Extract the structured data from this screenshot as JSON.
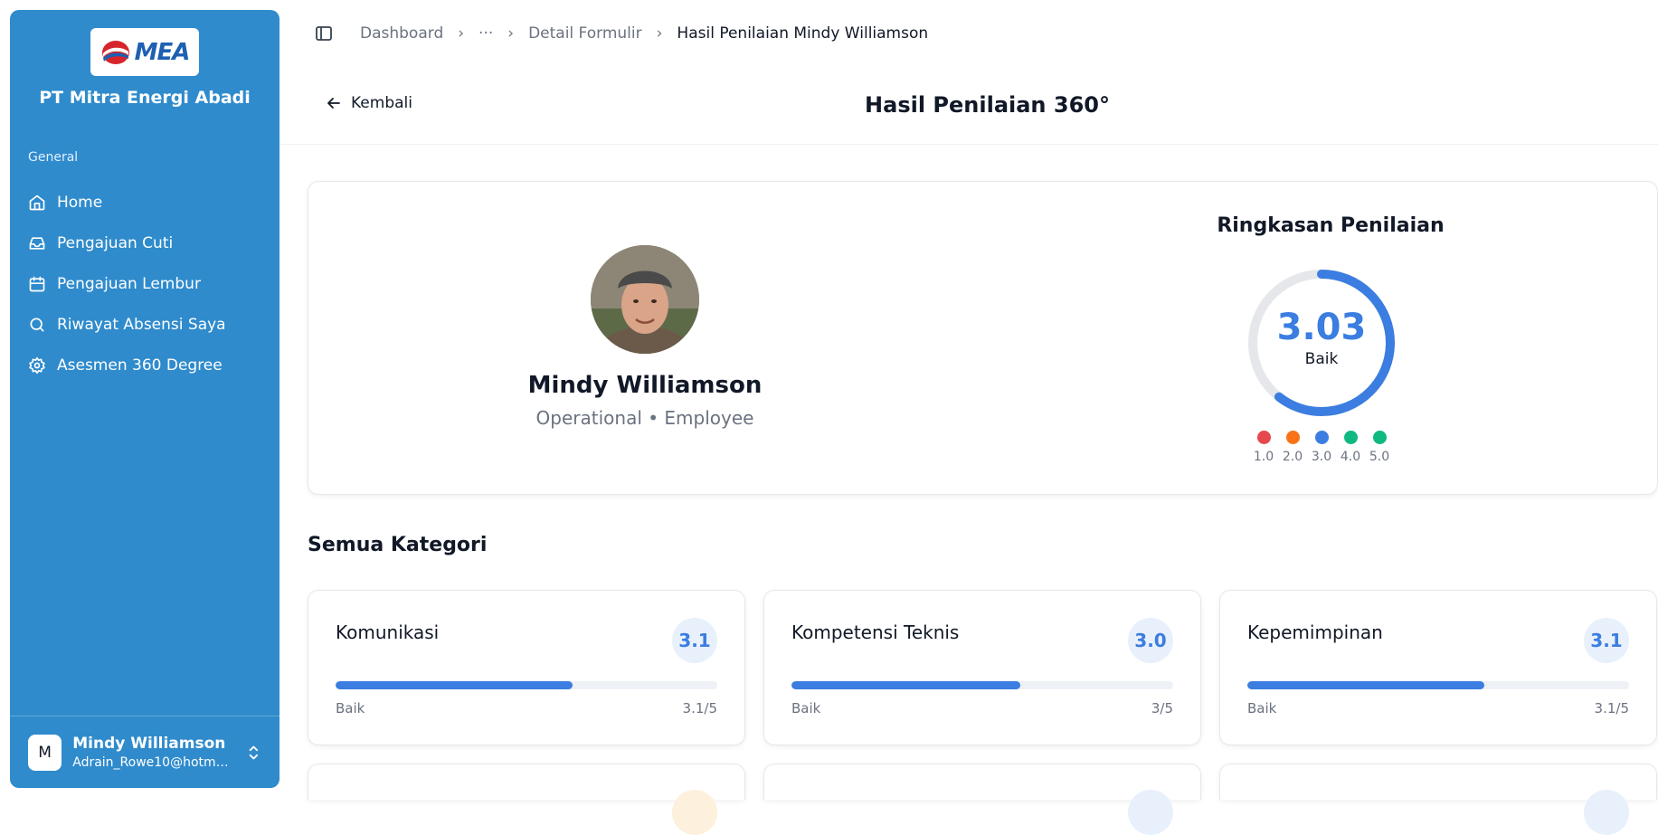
{
  "sidebar": {
    "logo_text": "MEA",
    "company": "PT Mitra Energi Abadi",
    "group_label": "General",
    "items": [
      {
        "label": "Home",
        "icon": "home-icon"
      },
      {
        "label": "Pengajuan Cuti",
        "icon": "inbox-icon"
      },
      {
        "label": "Pengajuan Lembur",
        "icon": "calendar-icon"
      },
      {
        "label": "Riwayat Absensi Saya",
        "icon": "search-icon"
      },
      {
        "label": "Asesmen 360 Degree",
        "icon": "gear-icon"
      }
    ],
    "user": {
      "initial": "M",
      "name": "Mindy Williamson",
      "email": "Adrain_Rowe10@hotmail.com"
    }
  },
  "breadcrumb": {
    "items": [
      "Dashboard",
      "···",
      "Detail Formulir"
    ],
    "current": "Hasil Penilaian Mindy Williamson"
  },
  "header": {
    "back_label": "Kembali",
    "title": "Hasil Penilaian 360°"
  },
  "profile": {
    "name": "Mindy Williamson",
    "role": "Operational • Employee"
  },
  "summary": {
    "title": "Ringkasan Penilaian",
    "score": "3.03",
    "score_value": 3.03,
    "score_max": 5,
    "label": "Baik",
    "scale": [
      {
        "value": "1.0",
        "color": "#e5484d"
      },
      {
        "value": "2.0",
        "color": "#f97316"
      },
      {
        "value": "3.0",
        "color": "#3b7de0"
      },
      {
        "value": "4.0",
        "color": "#10b981"
      },
      {
        "value": "5.0",
        "color": "#10b981"
      }
    ]
  },
  "categories": {
    "title": "Semua Kategori",
    "items": [
      {
        "name": "Komunikasi",
        "badge": "3.1",
        "label": "Baik",
        "score": "3.1/5",
        "value": 3.1
      },
      {
        "name": "Kompetensi Teknis",
        "badge": "3.0",
        "label": "Baik",
        "score": "3/5",
        "value": 3.0
      },
      {
        "name": "Kepemimpinan",
        "badge": "3.1",
        "label": "Baik",
        "score": "3.1/5",
        "value": 3.1
      }
    ]
  },
  "colors": {
    "sidebar": "#2f8bcc",
    "accent": "#3b7de0"
  }
}
